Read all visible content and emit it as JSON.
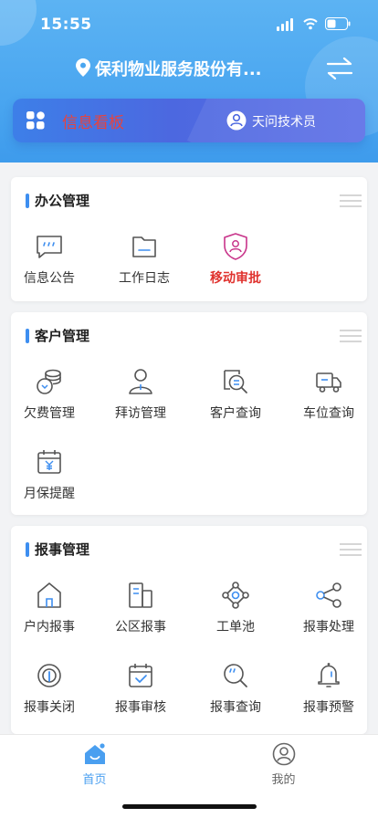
{
  "status": {
    "time": "15:55"
  },
  "header": {
    "company": "保利物业服务股份有...",
    "board_label": "信息看板",
    "user_label": "天问技术员"
  },
  "sections": [
    {
      "title": "办公管理",
      "items": [
        {
          "label": "信息公告",
          "icon": "message-icon",
          "highlight": false
        },
        {
          "label": "工作日志",
          "icon": "folder-icon",
          "highlight": false
        },
        {
          "label": "移动审批",
          "icon": "shield-user-icon",
          "highlight": true
        }
      ]
    },
    {
      "title": "客户管理",
      "items": [
        {
          "label": "欠费管理",
          "icon": "coins-icon"
        },
        {
          "label": "拜访管理",
          "icon": "person-icon"
        },
        {
          "label": "客户查询",
          "icon": "search-doc-icon"
        },
        {
          "label": "车位查询",
          "icon": "truck-icon"
        },
        {
          "label": "月保提醒",
          "icon": "calendar-yen-icon"
        }
      ]
    },
    {
      "title": "报事管理",
      "items": [
        {
          "label": "户内报事",
          "icon": "house-icon"
        },
        {
          "label": "公区报事",
          "icon": "building-icon"
        },
        {
          "label": "工单池",
          "icon": "network-icon"
        },
        {
          "label": "报事处理",
          "icon": "share-icon"
        },
        {
          "label": "报事关闭",
          "icon": "target-icon"
        },
        {
          "label": "报事审核",
          "icon": "calendar-check-icon"
        },
        {
          "label": "报事查询",
          "icon": "magnifier-icon"
        },
        {
          "label": "报事预警",
          "icon": "bell-icon"
        }
      ]
    }
  ],
  "tabbar": {
    "home_label": "首页",
    "mine_label": "我的",
    "active_color": "#4a9ff0",
    "inactive_color": "#666666"
  }
}
